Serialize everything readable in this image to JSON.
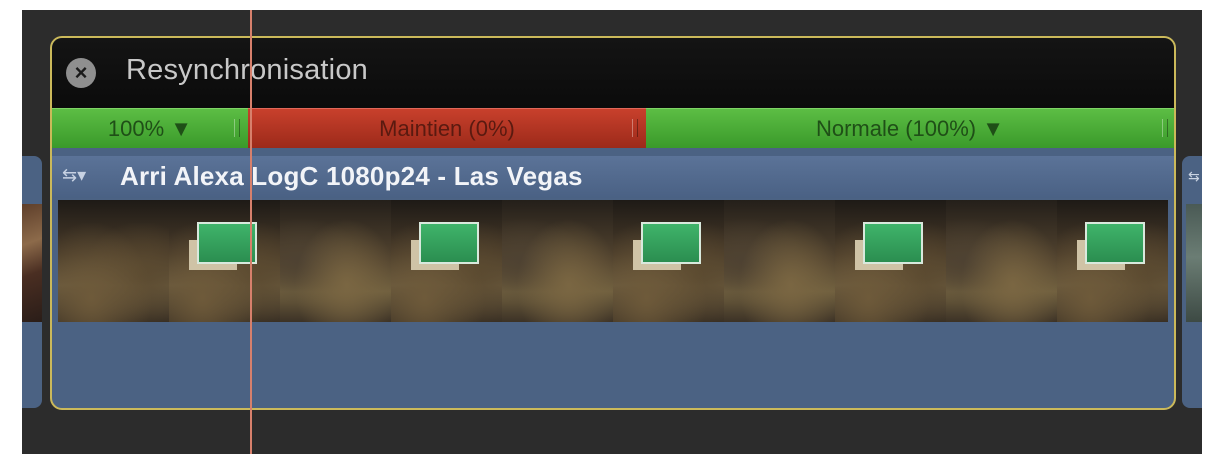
{
  "retime": {
    "close_icon": "close-icon",
    "title": "Resynchronisation",
    "segments": [
      {
        "label": "100% ▼",
        "color": "#4aa933"
      },
      {
        "label": "Maintien (0%)",
        "color": "#b3351f"
      },
      {
        "label": "Normale (100%) ▼",
        "color": "#4aa933"
      }
    ]
  },
  "clip": {
    "icon": "clip-settings-icon",
    "name": "Arri Alexa LogC 1080p24 - Las Vegas"
  },
  "colors": {
    "outline": "#cbb95a",
    "clip_bg": "#4b6283",
    "playhead": "#d7806c",
    "timeline_bg": "#2c2c2c"
  }
}
